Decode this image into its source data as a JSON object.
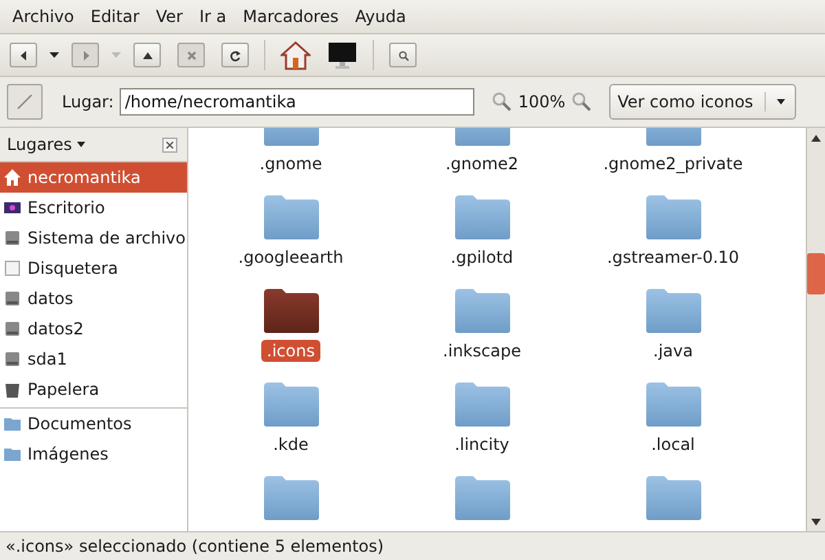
{
  "menu": [
    {
      "label": "Archivo"
    },
    {
      "label": "Editar"
    },
    {
      "label": "Ver"
    },
    {
      "label": "Ir a"
    },
    {
      "label": "Marcadores"
    },
    {
      "label": "Ayuda"
    }
  ],
  "toolbar": [
    {
      "kind": "back",
      "disabled": false
    },
    {
      "kind": "dropdown",
      "disabled": false
    },
    {
      "kind": "forward",
      "disabled": true
    },
    {
      "kind": "dropdown",
      "disabled": true
    },
    {
      "kind": "up",
      "disabled": false
    },
    {
      "kind": "stop",
      "disabled": true
    },
    {
      "kind": "reload",
      "disabled": false
    },
    {
      "kind": "separator"
    },
    {
      "kind": "home"
    },
    {
      "kind": "computer"
    },
    {
      "kind": "separator"
    },
    {
      "kind": "search",
      "disabled": false
    }
  ],
  "location": {
    "label": "Lugar:",
    "value": "/home/necromantika",
    "zoom": "100%",
    "view": "Ver como iconos"
  },
  "sidebar": {
    "title": "Lugares",
    "sections": [
      [
        {
          "label": "necromantika",
          "kind": "home",
          "selected": true
        },
        {
          "label": "Escritorio",
          "kind": "desktop",
          "selected": false
        },
        {
          "label": "Sistema de archivo",
          "kind": "drive",
          "selected": false
        },
        {
          "label": "Disquetera",
          "kind": "floppy",
          "selected": false
        },
        {
          "label": "datos",
          "kind": "drive",
          "selected": false
        },
        {
          "label": "datos2",
          "kind": "drive",
          "selected": false
        },
        {
          "label": "sda1",
          "kind": "drive",
          "selected": false
        },
        {
          "label": "Papelera",
          "kind": "trash",
          "selected": false
        }
      ],
      [
        {
          "label": "Documentos",
          "kind": "folder",
          "selected": false
        },
        {
          "label": "Imágenes",
          "kind": "folder",
          "selected": false
        }
      ]
    ]
  },
  "files": [
    {
      "kind": "labeled",
      "name": ".gnome",
      "selected": false
    },
    {
      "kind": "labeled",
      "name": ".gnome2",
      "selected": false
    },
    {
      "kind": "labeled",
      "name": ".gnome2_private",
      "selected": false
    },
    {
      "kind": "labeled",
      "name": ".googleearth",
      "selected": false
    },
    {
      "kind": "labeled",
      "name": ".gpilotd",
      "selected": false
    },
    {
      "kind": "labeled",
      "name": ".gstreamer-0.10",
      "selected": false
    },
    {
      "kind": "labeled",
      "name": ".icons",
      "selected": true
    },
    {
      "kind": "labeled",
      "name": ".inkscape",
      "selected": false
    },
    {
      "kind": "labeled",
      "name": ".java",
      "selected": false
    },
    {
      "kind": "labeled",
      "name": ".kde",
      "selected": false
    },
    {
      "kind": "labeled",
      "name": ".lincity",
      "selected": false
    },
    {
      "kind": "labeled",
      "name": ".local",
      "selected": false
    },
    {
      "kind": "cut"
    },
    {
      "kind": "cut"
    },
    {
      "kind": "cut"
    }
  ],
  "status_bar": "«.icons» seleccionado (contiene 5 elementos)"
}
